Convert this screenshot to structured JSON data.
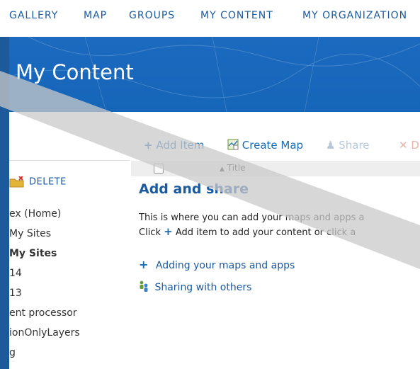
{
  "nav": {
    "items": [
      "GALLERY",
      "MAP",
      "GROUPS",
      "MY CONTENT",
      "MY ORGANIZATION"
    ]
  },
  "header": {
    "title": "My Content"
  },
  "sidebar": {
    "delete_label": "DELETE",
    "items": [
      {
        "label": "ex (Home)",
        "bold": false
      },
      {
        "label": "My Sites",
        "bold": false
      },
      {
        "label": "My Sites",
        "bold": true
      },
      {
        "label": "14",
        "bold": false
      },
      {
        "label": "13",
        "bold": false
      },
      {
        "label": "ent processor",
        "bold": false
      },
      {
        "label": "ionOnlyLayers",
        "bold": false
      },
      {
        "label": "g",
        "bold": false
      }
    ]
  },
  "toolbar": {
    "add_item_label": "Add Item",
    "create_map_label": "Create Map",
    "share_label": "Share",
    "delete_label": "D"
  },
  "table": {
    "title_column": "Title"
  },
  "empty_state": {
    "heading": "Add and share",
    "line1": "This is where you can add your maps and apps a",
    "line2": "Add item to add your content or click a",
    "line2_prefix": "Click",
    "links": [
      "Adding your maps and apps",
      "Sharing with others"
    ]
  },
  "colors": {
    "brand_blue": "#1565b9",
    "link_blue": "#1b5a9f",
    "frame_blue": "#1c5a9c"
  }
}
